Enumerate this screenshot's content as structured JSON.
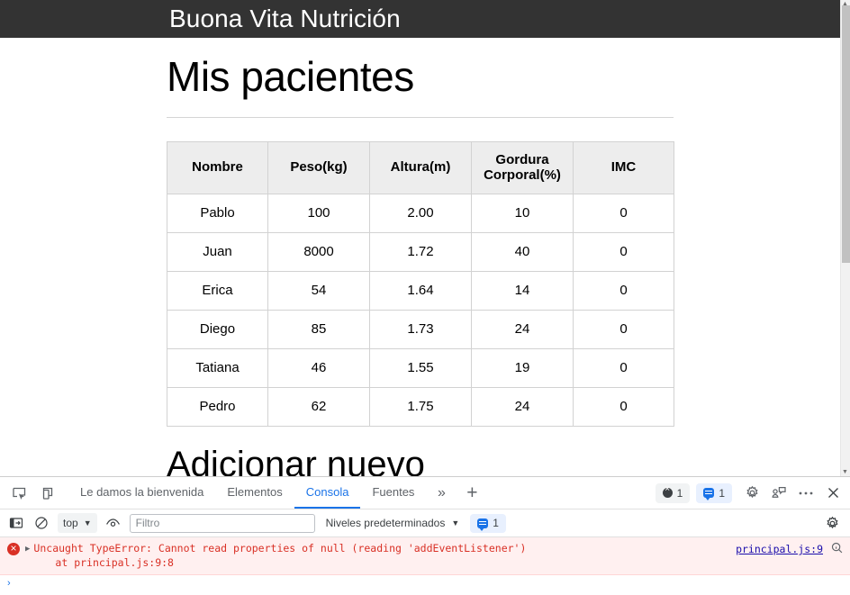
{
  "site": {
    "brand": "Buona Vita Nutrición",
    "header_bg": "#333333",
    "title": "Mis pacientes",
    "subtitle": "Adicionar nuevo"
  },
  "table": {
    "columns": [
      "Nombre",
      "Peso(kg)",
      "Altura(m)",
      "Gordura Corporal(%)",
      "IMC"
    ],
    "column_parts": {
      "gordura_line1": "Gordura",
      "gordura_line2": "Corporal(%)"
    },
    "rows": [
      {
        "nombre": "Pablo",
        "peso": "100",
        "altura": "2.00",
        "gordura": "10",
        "imc": "0"
      },
      {
        "nombre": "Juan",
        "peso": "8000",
        "altura": "1.72",
        "gordura": "40",
        "imc": "0"
      },
      {
        "nombre": "Erica",
        "peso": "54",
        "altura": "1.64",
        "gordura": "14",
        "imc": "0"
      },
      {
        "nombre": "Diego",
        "peso": "85",
        "altura": "1.73",
        "gordura": "24",
        "imc": "0"
      },
      {
        "nombre": "Tatiana",
        "peso": "46",
        "altura": "1.55",
        "gordura": "19",
        "imc": "0"
      },
      {
        "nombre": "Pedro",
        "peso": "62",
        "altura": "1.75",
        "gordura": "24",
        "imc": "0"
      }
    ]
  },
  "devtools": {
    "icons": {
      "inspect": "inspect-element-icon",
      "device": "device-toolbar-icon",
      "settings": "gear-icon",
      "feedback": "feedback-icon",
      "more_tools": "more-options-icon",
      "close": "close-icon"
    },
    "tabs": [
      {
        "label": "Le damos la bienvenida",
        "active": false
      },
      {
        "label": "Elementos",
        "active": false
      },
      {
        "label": "Consola",
        "active": true
      },
      {
        "label": "Fuentes",
        "active": false
      }
    ],
    "overflow_label": "»",
    "add_tab_label": "+",
    "error_count": "1",
    "message_count": "1",
    "accent_color": "#1a73e8",
    "error_color": "#d93025",
    "toolbar": {
      "sidebar_toggle": "console-sidebar-icon",
      "clear_label": "clear-console-icon",
      "context": "top",
      "eye_label": "live-expression-icon",
      "filter_placeholder": "Filtro",
      "filter_value": "",
      "levels_label": "Niveles predeterminados",
      "levels_count": "1",
      "settings": "gear-icon"
    },
    "console": {
      "error_message": "Uncaught TypeError: Cannot read properties of null (reading 'addEventListener')",
      "error_stack": "at principal.js:9:8",
      "error_source": "principal.js:9",
      "expand_arrow": "▶",
      "info_icon": "magnify-info-icon",
      "prompt": "›"
    }
  }
}
